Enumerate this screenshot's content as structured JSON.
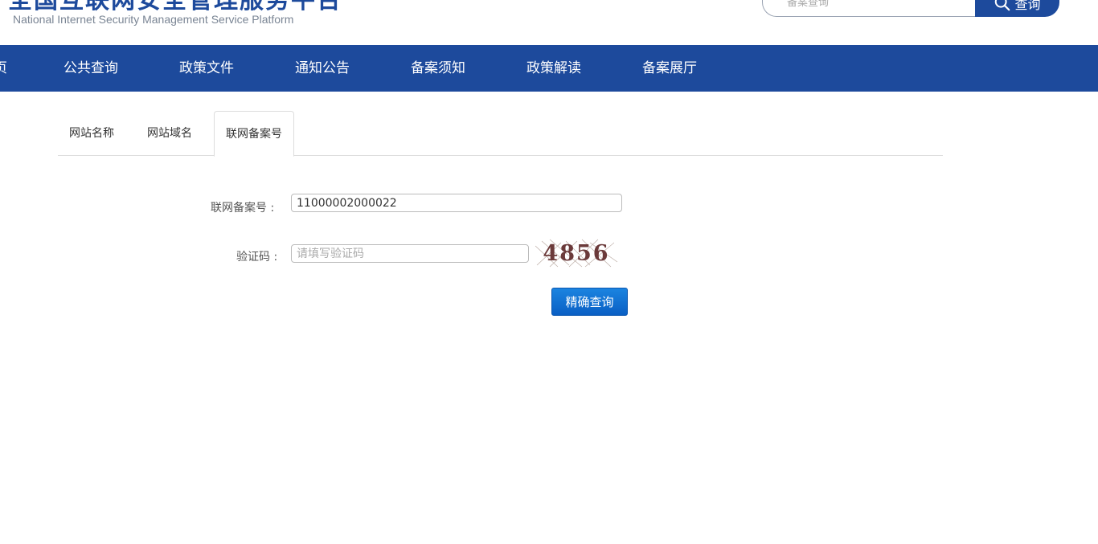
{
  "header": {
    "title": "全国互联网安全管理服务平台",
    "subtitle": "National Internet Security Management Service Platform",
    "search_placeholder": "备案查询",
    "search_button": "查询"
  },
  "nav": {
    "items": [
      {
        "label": "页"
      },
      {
        "label": "公共查询"
      },
      {
        "label": "政策文件"
      },
      {
        "label": "通知公告"
      },
      {
        "label": "备案须知"
      },
      {
        "label": "政策解读"
      },
      {
        "label": "备案展厅"
      }
    ]
  },
  "tabs": [
    {
      "label": "网站名称"
    },
    {
      "label": "网站域名"
    },
    {
      "label": "联网备案号"
    }
  ],
  "form": {
    "record_label": "联网备案号 :",
    "record_value": "11000002000022",
    "captcha_label": "验证码 :",
    "captcha_placeholder": "请填写验证码",
    "captcha_code": "4856",
    "submit_label": "精确查询"
  },
  "colors": {
    "brand": "#1d4a9c",
    "button": "#0a6cd6"
  }
}
